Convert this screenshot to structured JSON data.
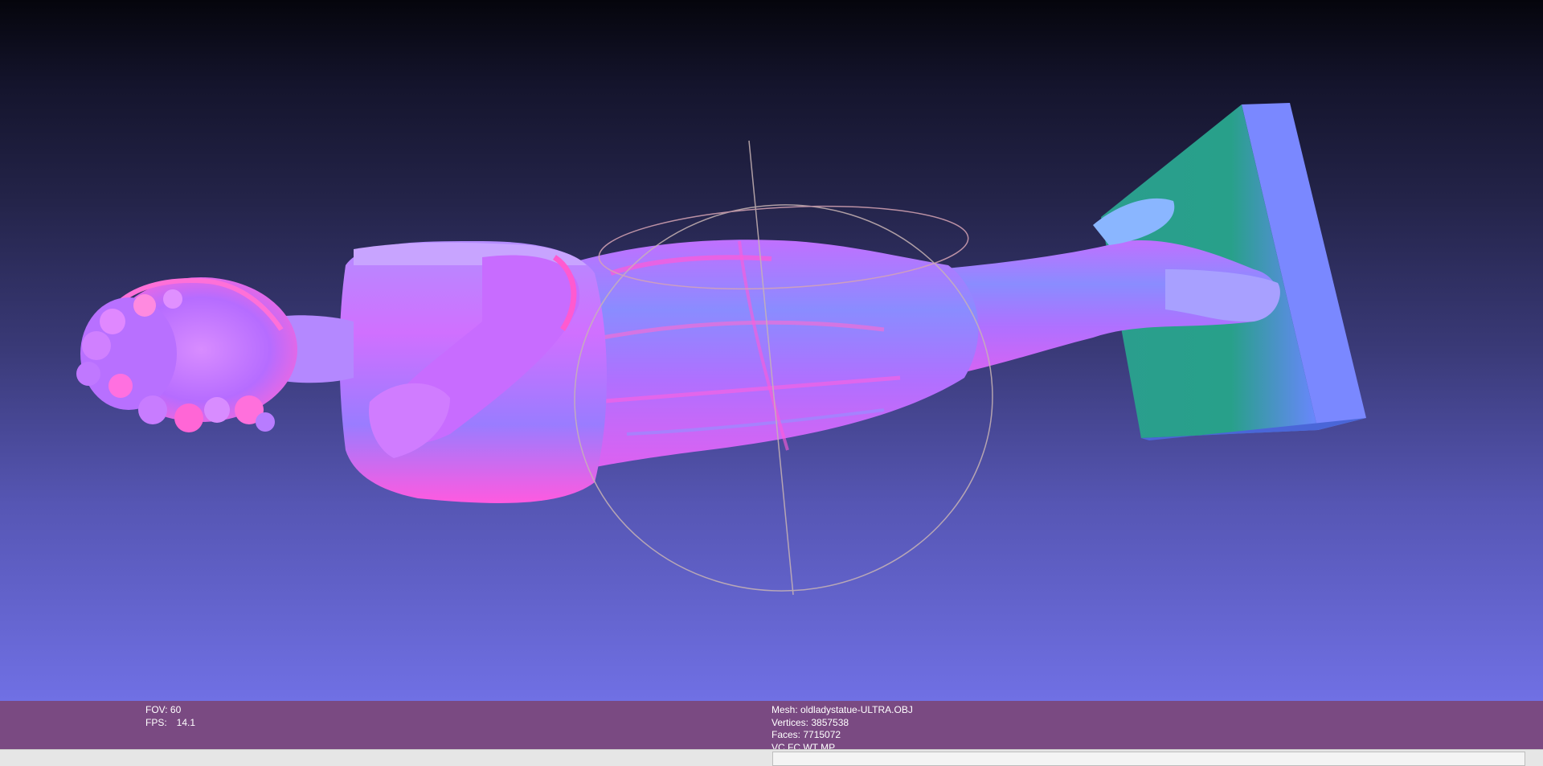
{
  "viewer": {
    "background_top": "#05050c",
    "background_bottom": "#7070e4",
    "model_shading": "normal-map",
    "trackball_color": "#c8b4b4"
  },
  "info_left": {
    "fov_label": "FOV: 60",
    "fps_label": "FPS:",
    "fps_value": "14.1"
  },
  "info_right": {
    "mesh": "Mesh: oldladystatue-ULTRA.OBJ",
    "vertices": "Vertices: 3857538",
    "faces": "Faces: 7715072",
    "flags": "VC FC WT MP"
  },
  "colors": {
    "info_bar": "#7a4a82",
    "bottom_strip": "#e6e6e6"
  }
}
